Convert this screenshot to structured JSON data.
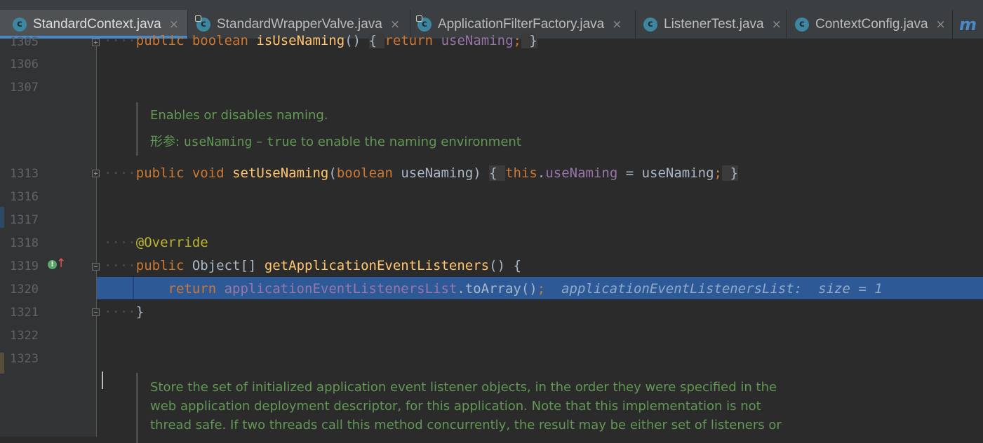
{
  "tabs": [
    {
      "label": "StandardContext.java",
      "active": true,
      "icon": "class-c-icon"
    },
    {
      "label": "StandardWrapperValve.java",
      "active": false,
      "icon": "class-c-locked-icon"
    },
    {
      "label": "ApplicationFilterFactory.java",
      "active": false,
      "icon": "class-c-locked-icon"
    },
    {
      "label": "ListenerTest.java",
      "active": false,
      "icon": "class-c-icon"
    },
    {
      "label": "ContextConfig.java",
      "active": false,
      "icon": "class-c-icon"
    }
  ],
  "tab_close_glyph": "×",
  "tab_overflow_logo": "m",
  "line_numbers": {
    "l1305": "1305",
    "l1306": "1306",
    "l1307": "1307",
    "l1313": "1313",
    "l1316": "1316",
    "l1317": "1317",
    "l1318": "1318",
    "l1319": "1319",
    "l1320": "1320",
    "l1321": "1321",
    "l1322": "1322",
    "l1323": "1323"
  },
  "code": {
    "is_use_naming": {
      "kw1": "public",
      "kw2": "boolean",
      "name": "isUseNaming",
      "tail": "()",
      "ret": "return",
      "field": "useNaming",
      "end": ";"
    },
    "set_use_naming": {
      "kw1": "public",
      "kw2": "void",
      "name": "setUseNaming",
      "open": "(",
      "ptype": "boolean",
      "pname": "useNaming",
      "close": ")",
      "this": "this",
      "field": "useNaming",
      "assign": " = ",
      "value": "useNaming",
      "end": ";"
    },
    "override": "@Override",
    "get_listeners": {
      "kw1": "public",
      "type": "Object[]",
      "name": "getApplicationEventListeners",
      "tail": "() {"
    },
    "return_line": {
      "ret": "return",
      "field": "applicationEventListenersList",
      "call": ".toArray()",
      "end": ";",
      "hint": "applicationEventListenersList:  size = 1"
    },
    "closing_brace": "}"
  },
  "docs": {
    "naming_summary": "Enables or disables naming.",
    "naming_param_label": "形参:",
    "naming_param_name": "useNaming",
    "naming_param_dash": "–",
    "naming_param_value": "true",
    "naming_param_text": "to enable the naming environment",
    "listeners_line1": "Store the set of initialized application event listener objects, in the order they were specified in the",
    "listeners_line2": "web application deployment descriptor, for this application. Note that this implementation is not",
    "listeners_line3": "thread safe. If two threads call this method concurrently, the result may be either set of listeners or"
  },
  "gutter_icons": {
    "override": "overriding-method-icon",
    "arrow": "up-arrow-icon"
  },
  "colors": {
    "keyword": "#cc7832",
    "method": "#ffc66d",
    "field": "#9876aa",
    "annotation": "#bbb529",
    "doc": "#629755",
    "selection": "#2d5a96"
  }
}
